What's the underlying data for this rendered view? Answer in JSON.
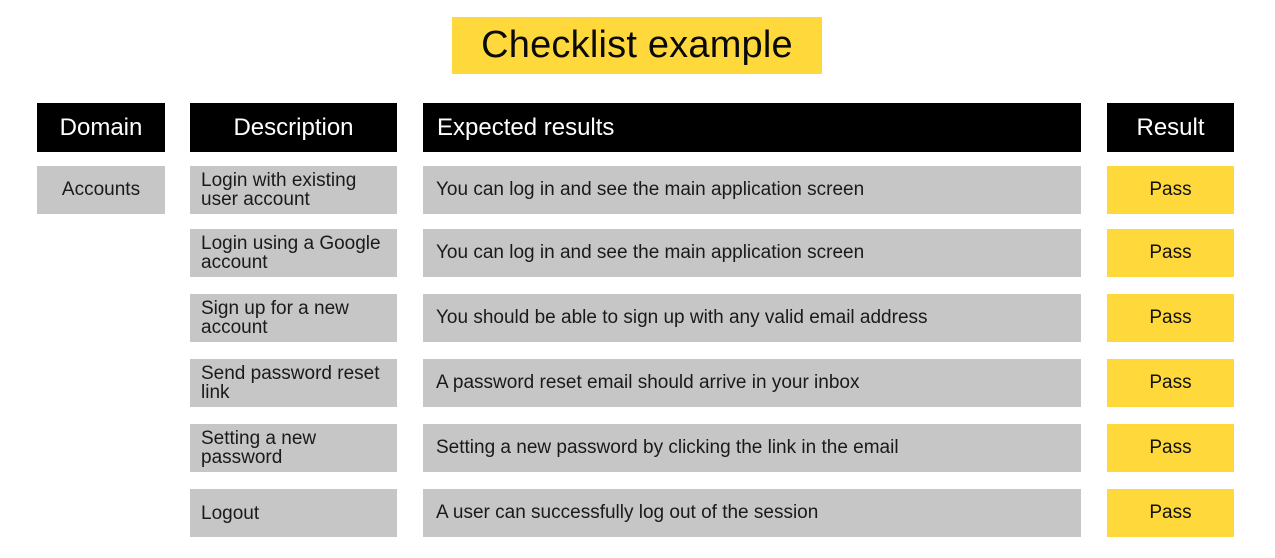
{
  "title": "Checklist example",
  "colors": {
    "accent_yellow": "#FFD93B",
    "header_black": "#000000",
    "cell_gray": "#C6C6C6"
  },
  "headers": {
    "domain": "Domain",
    "description": "Description",
    "expected": "Expected results",
    "result": "Result"
  },
  "domain": "Accounts",
  "rows": [
    {
      "description": "Login with existing user account",
      "expected": "You can log in and see the main application screen",
      "result": "Pass"
    },
    {
      "description": "Login using a Google account",
      "expected": "You can log in and see the main application screen",
      "result": "Pass"
    },
    {
      "description": "Sign up for a new account",
      "expected": "You should be able to sign up with any valid email address",
      "result": "Pass"
    },
    {
      "description": "Send password reset link",
      "expected": "A password reset email should arrive in your inbox",
      "result": "Pass"
    },
    {
      "description": "Setting a new password",
      "expected": "Setting a new password by clicking the link in the email",
      "result": "Pass"
    },
    {
      "description": "Logout",
      "expected": "A user can successfully log out of the session",
      "result": "Pass"
    }
  ]
}
